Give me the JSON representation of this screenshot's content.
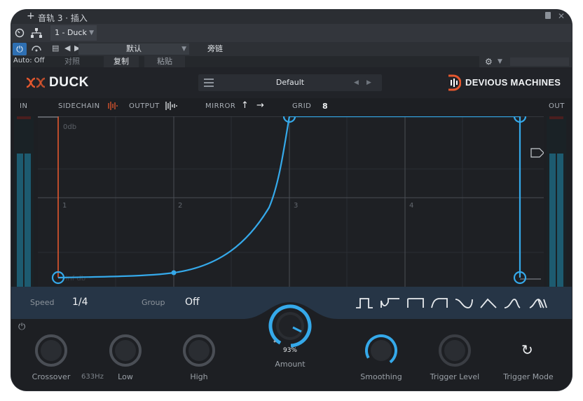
{
  "host": {
    "title": "音轨 3 · 插入",
    "track_tab": "1 - Duck",
    "preset_dropdown": "默认",
    "sidechain_label": "旁链",
    "auto_label": "Auto: Off",
    "compare_label": "对照",
    "copy_label": "复制",
    "paste_label": "粘贴"
  },
  "plugin": {
    "name": "DUCK",
    "preset": "Default",
    "brand": "DEVIOUS MACHINES",
    "labels": {
      "in": "IN",
      "sidechain": "SIDECHAIN",
      "output": "OUTPUT",
      "mirror": "MIRROR",
      "grid": "GRID",
      "grid_value": "8",
      "out": "OUT"
    },
    "graph": {
      "top_db": "0db",
      "bottom_db": "-inf db",
      "beats": [
        "1",
        "2",
        "3",
        "4"
      ]
    },
    "params": {
      "speed_label": "Speed",
      "speed_value": "1/4",
      "group_label": "Group",
      "group_value": "Off"
    },
    "knobs": {
      "crossover_label": "Crossover",
      "crossover_value": "633Hz",
      "low_label": "Low",
      "high_label": "High",
      "amount_label": "Amount",
      "amount_value": "93%",
      "amount_fraction": 0.93,
      "smoothing_label": "Smoothing",
      "trigger_level_label": "Trigger Level",
      "trigger_mode_label": "Trigger Mode"
    },
    "colors": {
      "accent": "#35a9ea",
      "sidechain": "#e4572e",
      "meter": "#1d5b70"
    }
  }
}
